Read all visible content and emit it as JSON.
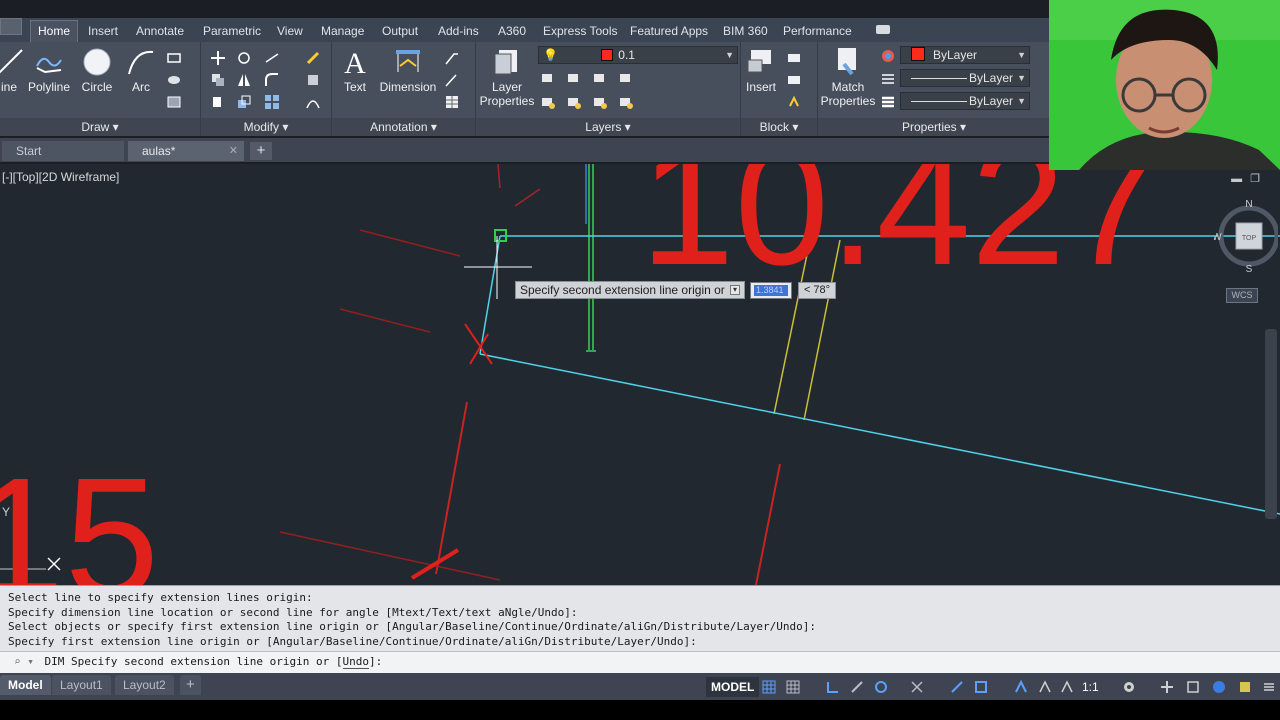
{
  "ribbon_tabs": [
    "Home",
    "Insert",
    "Annotate",
    "Parametric",
    "View",
    "Manage",
    "Output",
    "Add-ins",
    "A360",
    "Express Tools",
    "Featured Apps",
    "BIM 360",
    "Performance"
  ],
  "draw_panel": {
    "title": "Draw",
    "line_label": "ine",
    "polyline_label": "Polyline",
    "circle_label": "Circle",
    "arc_label": "Arc"
  },
  "modify_panel": {
    "title": "Modify"
  },
  "annotation_panel": {
    "title": "Annotation",
    "text_label": "Text",
    "dimension_label": "Dimension"
  },
  "layers_panel": {
    "title": "Layers",
    "layer_properties_label": "Layer Properties",
    "current_layer": "0.1"
  },
  "block_panel": {
    "title": "Block",
    "insert_label": "Insert"
  },
  "properties_panel": {
    "title": "Properties",
    "match_properties_label": "Match Properties",
    "color_value": "ByLayer",
    "linetype_value": "ByLayer",
    "lineweight_value": "ByLayer"
  },
  "file_tabs": {
    "start_label": "Start",
    "drawing_label": "aulas*"
  },
  "viewport": {
    "label": "[-][Top][2D Wireframe]"
  },
  "drawing_text": {
    "dim_big": "10.427",
    "dim_left": "15"
  },
  "dynamic_input": {
    "prompt": "Specify second extension line origin or",
    "value": "1.3841",
    "angle": "< 78°"
  },
  "viewcube": {
    "north": "N",
    "south": "S",
    "west": "W",
    "face": "TOP",
    "wcs": "WCS"
  },
  "command_history": [
    "Select line to specify extension lines origin:",
    "Specify dimension line location or second line for angle [Mtext/Text/text aNgle/Undo]:",
    "Select objects or specify first extension line origin or [Angular/Baseline/Continue/Ordinate/aliGn/Distribute/Layer/Undo]:",
    "Specify first extension line origin or [Angular/Baseline/Continue/Ordinate/aliGn/Distribute/Layer/Undo]:"
  ],
  "command_line": {
    "command": "DIM",
    "text_before": "Specify second extension line origin or [",
    "option": "Undo",
    "text_after": "]:"
  },
  "layout_tabs": [
    "Model",
    "Layout1",
    "Layout2"
  ],
  "status": {
    "model_label": "MODEL",
    "scale": "1:1"
  },
  "colors": {
    "dim_red": "#e0201a",
    "cyan_line": "#4fd3e8",
    "yellow_line": "#c9c032",
    "green_line": "#2fa84a",
    "webcam_green": "#39c63a"
  },
  "icons": [
    "line-icon",
    "polyline-icon",
    "circle-icon",
    "arc-icon",
    "text-icon",
    "dimension-icon",
    "layer-icon",
    "insert-icon",
    "match-properties-icon",
    "viewcube-icon",
    "grid-icon",
    "snap-icon",
    "annotation-scale-icon",
    "gear-icon",
    "plus-icon"
  ]
}
